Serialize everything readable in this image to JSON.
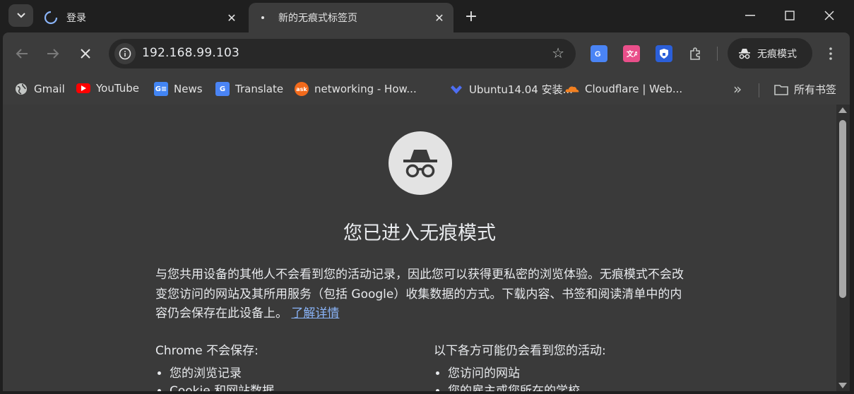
{
  "tabs": [
    {
      "title": "登录",
      "loading": true
    },
    {
      "title": "新的无痕式标签页",
      "active": true
    }
  ],
  "toolbar": {
    "url": "192.168.99.103",
    "incognito_label": "无痕模式"
  },
  "bookmarks": [
    {
      "label": "Gmail",
      "icon": "globe-icon"
    },
    {
      "label": "YouTube",
      "icon": "youtube-icon",
      "color": "#ff0000"
    },
    {
      "label": "News",
      "icon": "google-news-icon"
    },
    {
      "label": "Translate",
      "icon": "google-translate-icon"
    },
    {
      "label": "networking - How...",
      "icon": "ask-icon",
      "color": "#f26a1b"
    },
    {
      "label": "Ubuntu14.04 安装...",
      "icon": "diamond-icon",
      "color": "#4e6ef2"
    },
    {
      "label": "Cloudflare | Web...",
      "icon": "cloudflare-icon",
      "color": "#f38020"
    }
  ],
  "all_bookmarks_label": "所有书签",
  "content": {
    "title": "您已进入无痕模式",
    "description": "与您共用设备的其他人不会看到您的活动记录，因此您可以获得更私密的浏览体验。无痕模式不会改变您访问的网站及其所用服务（包括 Google）收集数据的方式。下载内容、书签和阅读清单中的内容仍会保存在此设备上。",
    "learn_more": "了解详情",
    "left_col": {
      "heading": "Chrome 不会保存:",
      "items": [
        "您的浏览记录",
        "Cookie 和网站数据"
      ]
    },
    "right_col": {
      "heading": "以下各方可能仍会看到您的活动:",
      "items": [
        "您访问的网站",
        "您的雇主或您所在的学校"
      ]
    }
  }
}
